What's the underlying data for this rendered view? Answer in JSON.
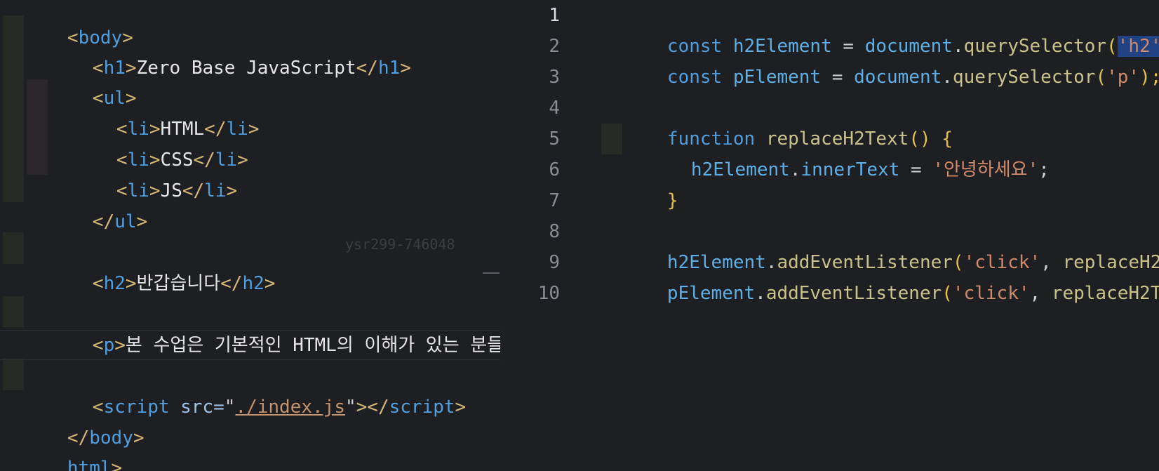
{
  "left_editor": {
    "lines": [
      {
        "open": "<",
        "tag": "body",
        "close": ">",
        "text": ""
      },
      {
        "open": "<",
        "tag": "h1",
        "close": ">",
        "text": "Zero Base JavaScript",
        "endopen": "</",
        "endtag": "h1",
        "endclose": ">"
      },
      {
        "open": "<",
        "tag": "ul",
        "close": ">"
      },
      {
        "open": "<",
        "tag": "li",
        "close": ">",
        "text": "HTML",
        "endopen": "</",
        "endtag": "li",
        "endclose": ">"
      },
      {
        "open": "<",
        "tag": "li",
        "close": ">",
        "text": "CSS",
        "endopen": "</",
        "endtag": "li",
        "endclose": ">"
      },
      {
        "open": "<",
        "tag": "li",
        "close": ">",
        "text": "JS",
        "endopen": "</",
        "endtag": "li",
        "endclose": ">"
      },
      {
        "open": "</",
        "tag": "ul",
        "close": ">"
      },
      {
        "open": "<",
        "tag": "h2",
        "close": ">",
        "text": "반갑습니다",
        "endopen": "</",
        "endtag": "h2",
        "endclose": ">"
      },
      {
        "open": "<",
        "tag": "p",
        "close": ">",
        "text": "본 수업은 기본적인 HTML의 이해가 있는 분들을"
      },
      {
        "open": "<",
        "tag": "script",
        "attr": " src=",
        "q1": "\"",
        "src": "./index.js",
        "q2": "\"",
        "close": ">",
        "endopen": "</",
        "endtag": "script",
        "endclose": ">"
      },
      {
        "open": "</",
        "tag": "body",
        "close": ">"
      },
      {
        "tag": "html",
        "close": ">"
      }
    ],
    "watermark": "ysr299-746048"
  },
  "right_editor": {
    "line_numbers": [
      "1",
      "2",
      "3",
      "4",
      "5",
      "6",
      "7",
      "8",
      "9",
      "10"
    ],
    "code": {
      "l1": {
        "kw": "const",
        "var": "h2Element",
        "eq": " = ",
        "obj": "document",
        "dot": ".",
        "fn": "querySelector",
        "paren": "(",
        "str": "'h2'"
      },
      "l2": {
        "kw": "const",
        "var": "pElement",
        "eq": " = ",
        "obj": "document",
        "dot": ".",
        "fn": "querySelector",
        "paren": "(",
        "str": "'p'",
        "end": ");"
      },
      "l4": {
        "kw": "function",
        "fn": "replaceH2Text",
        "paren": "()",
        "brace": " {"
      },
      "l5": {
        "var": "h2Element",
        "dot": ".",
        "prop": "innerText",
        "eq": " = ",
        "str": "'안녕하세요'",
        "end": ";"
      },
      "l6": {
        "brace": "}"
      },
      "l8": {
        "var": "h2Element",
        "dot": ".",
        "fn": "addEventListener",
        "paren": "(",
        "str": "'click'",
        "comma": ", ",
        "arg": "replaceH2"
      },
      "l9": {
        "var": "pElement",
        "dot": ".",
        "fn": "addEventListener",
        "paren": "(",
        "str": "'click'",
        "comma": ", ",
        "arg": "replaceH2T"
      }
    }
  }
}
